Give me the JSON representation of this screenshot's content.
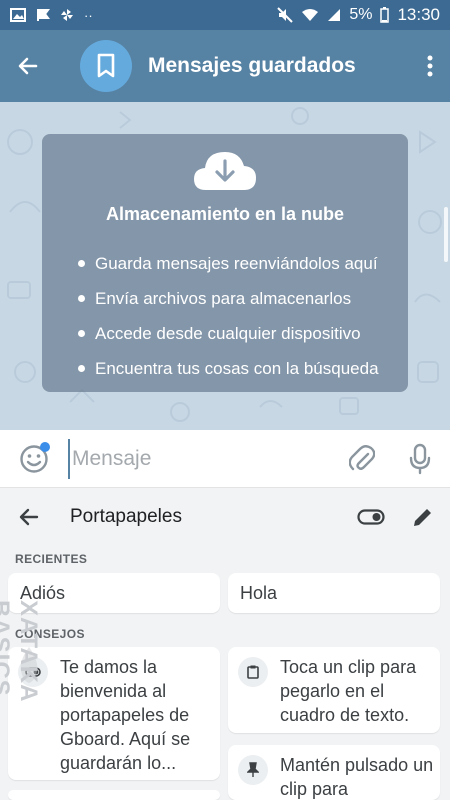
{
  "status_bar": {
    "battery": "5%",
    "time": "13:30",
    "left_icons": [
      "image-icon",
      "flag-icon",
      "pinwheel-icon",
      "more-dots-icon"
    ],
    "right_icons": [
      "mute-icon",
      "wifi-icon",
      "signal-icon",
      "battery-icon"
    ]
  },
  "app_bar": {
    "title": "Mensajes guardados",
    "color": "#5682a3",
    "avatar_color": "#65aadd",
    "avatar_icon": "bookmark-icon"
  },
  "cloud_card": {
    "icon": "cloud-download-icon",
    "title": "Almacenamiento en la nube",
    "items": [
      "Guarda mensajes reenviándolos aquí",
      "Envía archivos para almacenarlos",
      "Accede desde cualquier dispositivo",
      "Encuentra tus cosas con la búsqueda"
    ]
  },
  "composer": {
    "placeholder": "Mensaje",
    "icons": [
      "emoji-icon",
      "paperclip-icon",
      "microphone-icon"
    ]
  },
  "clipboard": {
    "title": "Portapapeles",
    "recent_label": "RECIENTES",
    "recent_items": [
      "Adiós",
      "Hola"
    ],
    "tips_label": "CONSEJOS",
    "tips": [
      "Te damos la bienvenida al portapapeles de Gboard. Aquí se guardarán lo...",
      "Toca un clip para pegarlo en el cuadro de texto.",
      "Mantén pulsado un clip para"
    ]
  },
  "watermark": "XATAKA BASICS"
}
